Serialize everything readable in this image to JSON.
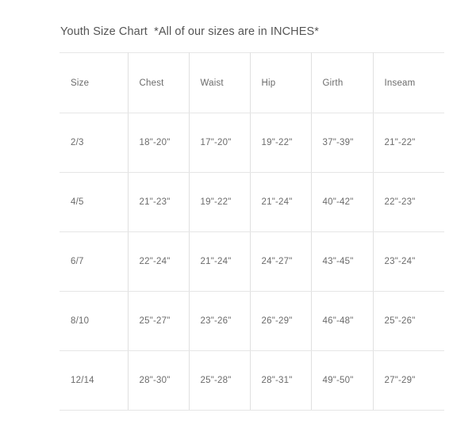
{
  "title": "Youth Size Chart  *All of our sizes are in INCHES*",
  "table": {
    "headers": [
      "Size",
      "Chest",
      "Waist",
      "Hip",
      "Girth",
      "Inseam"
    ],
    "rows": [
      {
        "size": "2/3",
        "chest": "18\"-20\"",
        "waist": "17\"-20\"",
        "hip": "19\"-22\"",
        "girth": "37\"-39\"",
        "inseam": "21\"-22\""
      },
      {
        "size": "4/5",
        "chest": "21\"-23\"",
        "waist": "19\"-22\"",
        "hip": "21\"-24\"",
        "girth": "40\"-42\"",
        "inseam": "22\"-23\""
      },
      {
        "size": "6/7",
        "chest": "22\"-24\"",
        "waist": "21\"-24\"",
        "hip": "24\"-27\"",
        "girth": "43\"-45\"",
        "inseam": "23\"-24\""
      },
      {
        "size": "8/10",
        "chest": "25\"-27\"",
        "waist": "23\"-26\"",
        "hip": "26\"-29\"",
        "girth": "46\"-48\"",
        "inseam": "25\"-26\""
      },
      {
        "size": "12/14",
        "chest": "28\"-30\"",
        "waist": "25\"-28\"",
        "hip": "28\"-31\"",
        "girth": "49\"-50\"",
        "inseam": "27\"-29\""
      }
    ]
  },
  "colors": {
    "background": "#ffffff",
    "title_text": "#555555",
    "cell_text": "#6b6b6b",
    "border": "#e6e6e6"
  }
}
